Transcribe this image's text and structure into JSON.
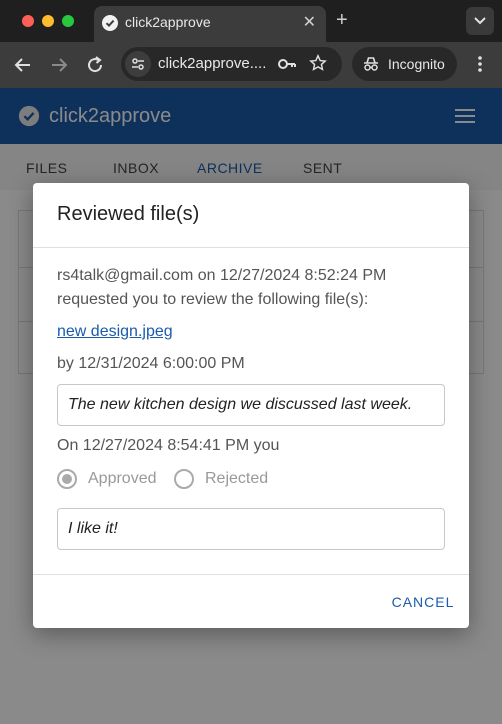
{
  "browser": {
    "tab_title": "click2approve",
    "url": "click2approve....",
    "incognito_label": "Incognito"
  },
  "app": {
    "title": "click2approve",
    "nav_tabs": [
      "FILES",
      "INBOX",
      "ARCHIVE",
      "SENT"
    ],
    "active_tab": "ARCHIVE"
  },
  "dialog": {
    "title": "Reviewed file(s)",
    "request_line1": "rs4talk@gmail.com on 12/27/2024 8:52:24 PM",
    "request_line2": "requested you to review the following file(s):",
    "file_name": "new design.jpeg",
    "due": "by 12/31/2024 6:00:00 PM",
    "description": "The new kitchen design we discussed last week.",
    "response_line": "On 12/27/2024 8:54:41 PM you",
    "options": {
      "approved": "Approved",
      "rejected": "Rejected"
    },
    "selected": "Approved",
    "comment": "I like it!",
    "cancel_label": "CANCEL"
  },
  "colors": {
    "brand": "#1a5bab"
  }
}
